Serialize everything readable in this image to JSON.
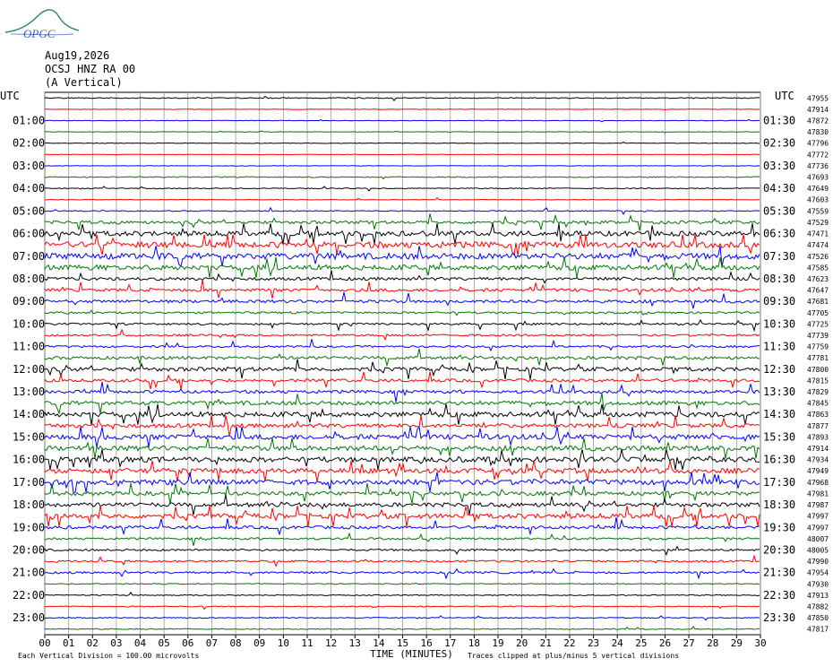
{
  "logo": {
    "text": "OPGC"
  },
  "header": {
    "date": "Aug19,2026",
    "station": "OCSJ HNZ RA 00",
    "component": "(A Vertical)"
  },
  "chart_data": {
    "type": "line",
    "title": "",
    "xlabel": "TIME (MINUTES)",
    "left_axis_label": "UTC",
    "right_axis_label": "UTC",
    "xlim": [
      0,
      30
    ],
    "x_ticks": [
      "00",
      "01",
      "02",
      "03",
      "04",
      "05",
      "06",
      "07",
      "08",
      "09",
      "10",
      "11",
      "12",
      "13",
      "14",
      "15",
      "16",
      "17",
      "18",
      "19",
      "20",
      "21",
      "22",
      "23",
      "24",
      "25",
      "26",
      "27",
      "28",
      "29",
      "30"
    ],
    "left_time_labels": [
      "01:00",
      "02:00",
      "03:00",
      "04:00",
      "05:00",
      "06:00",
      "07:00",
      "08:00",
      "09:00",
      "10:00",
      "11:00",
      "12:00",
      "13:00",
      "14:00",
      "15:00",
      "16:00",
      "17:00",
      "18:00",
      "19:00",
      "20:00",
      "21:00",
      "22:00",
      "23:00"
    ],
    "right_time_labels": [
      "01:30",
      "02:30",
      "03:30",
      "04:30",
      "05:30",
      "06:30",
      "07:30",
      "08:30",
      "09:30",
      "10:30",
      "11:30",
      "12:30",
      "13:30",
      "14:30",
      "15:30",
      "16:30",
      "17:30",
      "18:30",
      "19:30",
      "20:30",
      "21:30",
      "22:30",
      "23:30"
    ],
    "trace_colors": [
      "#000000",
      "#ff0000",
      "#0000ff",
      "#007700"
    ],
    "right_counts": [
      47955,
      47914,
      47872,
      47830,
      47796,
      47772,
      47736,
      47693,
      47649,
      47603,
      47559,
      47529,
      47471,
      47474,
      47526,
      47585,
      47623,
      47647,
      47681,
      47705,
      47725,
      47739,
      47759,
      47781,
      47800,
      47815,
      47829,
      47845,
      47863,
      47877,
      47893,
      47914,
      47934,
      47949,
      47968,
      47981,
      47987,
      47997,
      47997,
      48007,
      48005,
      47990,
      47954,
      47930,
      47913,
      47882,
      47850,
      47817
    ],
    "activity_levels": [
      1,
      0.5,
      0.5,
      0.5,
      0.5,
      0.5,
      0.5,
      1,
      1,
      0.5,
      1,
      3,
      5,
      6,
      6,
      5,
      3,
      3,
      3,
      2,
      2,
      2,
      2,
      3,
      4,
      3,
      3,
      4,
      5,
      4,
      5,
      5,
      5,
      5,
      5,
      4,
      4,
      5,
      3,
      2,
      2,
      2,
      2,
      1,
      1,
      1,
      1,
      1
    ],
    "footer_left": "Each Vertical Division =  100.00 microvolts",
    "footer_right": "Traces clipped at plus/minus 5 vertical divisions"
  }
}
